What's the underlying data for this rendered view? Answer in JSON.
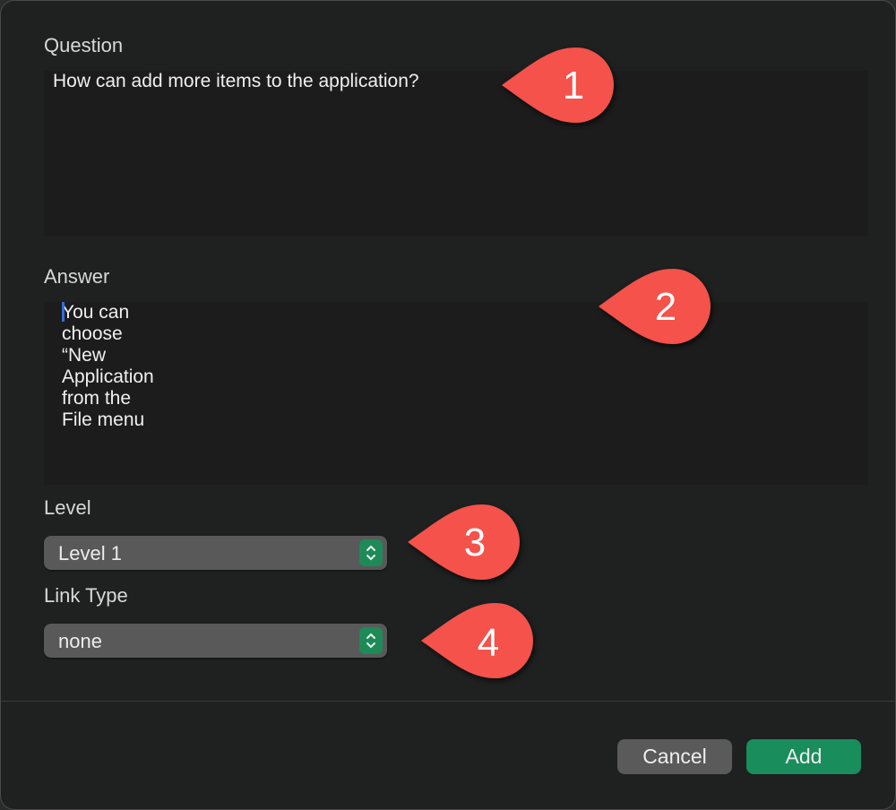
{
  "form": {
    "question_label": "Question",
    "question_value": "How can add more items to the application?",
    "answer_label": "Answer",
    "answer_value": "You can choose “New Application from the File menu",
    "level_label": "Level",
    "level_value": "Level 1",
    "link_type_label": "Link Type",
    "link_type_value": "none"
  },
  "buttons": {
    "cancel": "Cancel",
    "add": "Add"
  },
  "callouts": [
    "1",
    "2",
    "3",
    "4"
  ],
  "colors": {
    "accent": "#1e8a58",
    "callout": "#f4524a",
    "background": "#1f2020"
  }
}
